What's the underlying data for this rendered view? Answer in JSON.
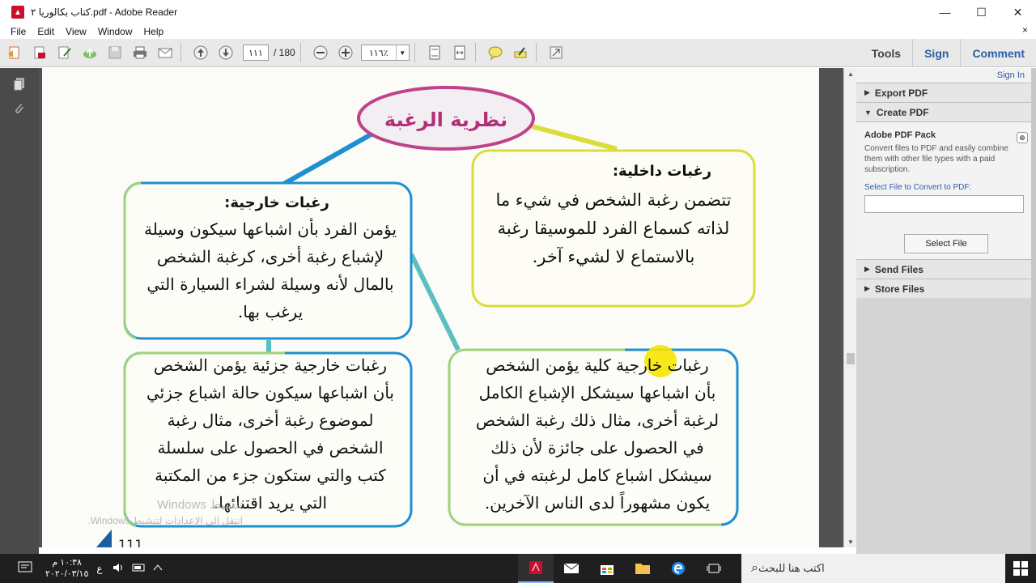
{
  "window": {
    "title": "كتاب بكالوريا ٢.pdf - Adobe Reader",
    "controls": {
      "minimize": "—",
      "maximize": "☐",
      "close": "✕"
    }
  },
  "menubar": {
    "items": [
      "File",
      "Edit",
      "View",
      "Window",
      "Help"
    ],
    "close": "×"
  },
  "toolbar": {
    "page_current": "١١١",
    "page_total": "/ 180",
    "zoom": "١١٦٪",
    "right_tabs": [
      "Tools",
      "Sign",
      "Comment"
    ]
  },
  "right_panel": {
    "sign_in": "Sign In",
    "export_pdf": "Export PDF",
    "create_pdf": "Create PDF",
    "pack_title": "Adobe PDF Pack",
    "pack_desc": "Convert files to PDF and easily combine them with other file types with a paid subscription.",
    "select_label": "Select File to Convert to PDF:",
    "select_button": "Select File",
    "send_files": "Send Files",
    "store_files": "Store Files"
  },
  "diagram": {
    "center": "نظرية الرغبة",
    "internal": {
      "heading": "رغبات داخلية:",
      "lines": [
        "تتضمن رغبة الشخص في شيء ما",
        "لذاته كسماع الفرد للموسيقا رغبة",
        "بالاستماع لا لشيء آخر."
      ]
    },
    "external": {
      "heading": "رغبات خارجية:",
      "lines": [
        "يؤمن الفرد بأن اشباعها سيكون وسيلة",
        "لإشباع رغبة أخرى، كرغبة الشخص",
        "بالمال لأنه وسيلة لشراء السيارة التي",
        "يرغب بها."
      ]
    },
    "partial": {
      "lines": [
        "رغبات خارجية جزئية يؤمن الشخص",
        "بأن اشباعها سيكون حالة اشباع جزئي",
        "لموضوع رغبة أخرى، مثال رغبة",
        "الشخص في الحصول على سلسلة",
        "كتب والتي ستكون جزء من المكتبة",
        "التي يريد اقتنائها."
      ]
    },
    "total": {
      "lines": [
        "رغبات خارجية كلية يؤمن الشخص",
        "بأن اشباعها سيشكل الإشباع الكامل",
        "لرغبة أخرى، مثال ذلك رغبة الشخص",
        "في الحصول على جائزة لأن ذلك",
        "سيشكل اشباع كامل لرغبته في أن",
        "يكون مشهوراً لدى الناس الآخرين."
      ]
    },
    "page_number": "111",
    "colors": {
      "pink": "#c0428a",
      "blue": "#1e8fd0",
      "green": "#9fd37a",
      "yellow": "#d9dd3a",
      "teal": "#5bbfc0"
    }
  },
  "watermark": {
    "line1": "تنشيط Windows",
    "line2": "انتقل إلى الإعدادات لتنشيط Windows."
  },
  "taskbar": {
    "search_placeholder": "اكتب هنا للبحث",
    "time": "١٠:٣٨ م",
    "date": "٢٠٢٠/٠٣/١٥",
    "lang": "ع"
  }
}
